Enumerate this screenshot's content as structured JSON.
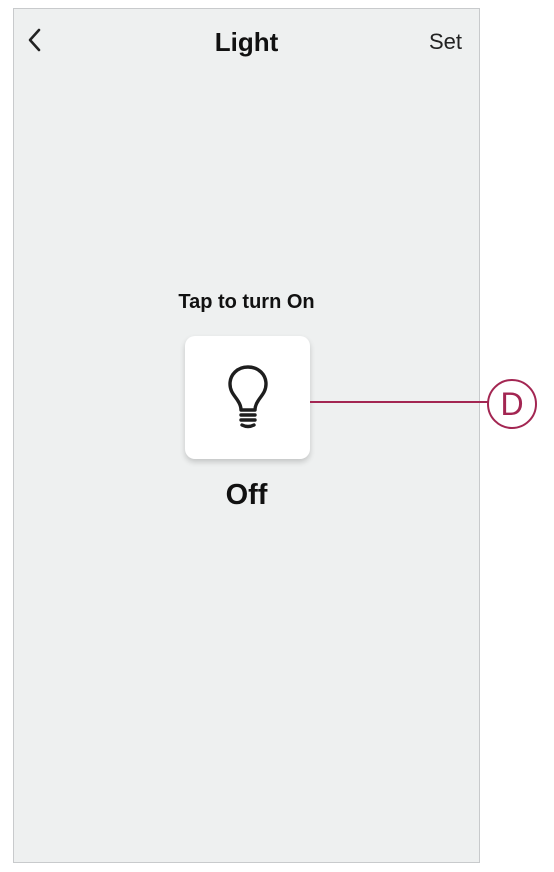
{
  "header": {
    "title": "Light",
    "set_label": "Set"
  },
  "main": {
    "hint": "Tap to turn On",
    "state_label": "Off",
    "tile_icon": "lightbulb-icon"
  },
  "callout": {
    "label": "D"
  },
  "colors": {
    "screen_background": "#eef0f0",
    "tile_background": "#ffffff",
    "callout_accent": "#a32652"
  }
}
